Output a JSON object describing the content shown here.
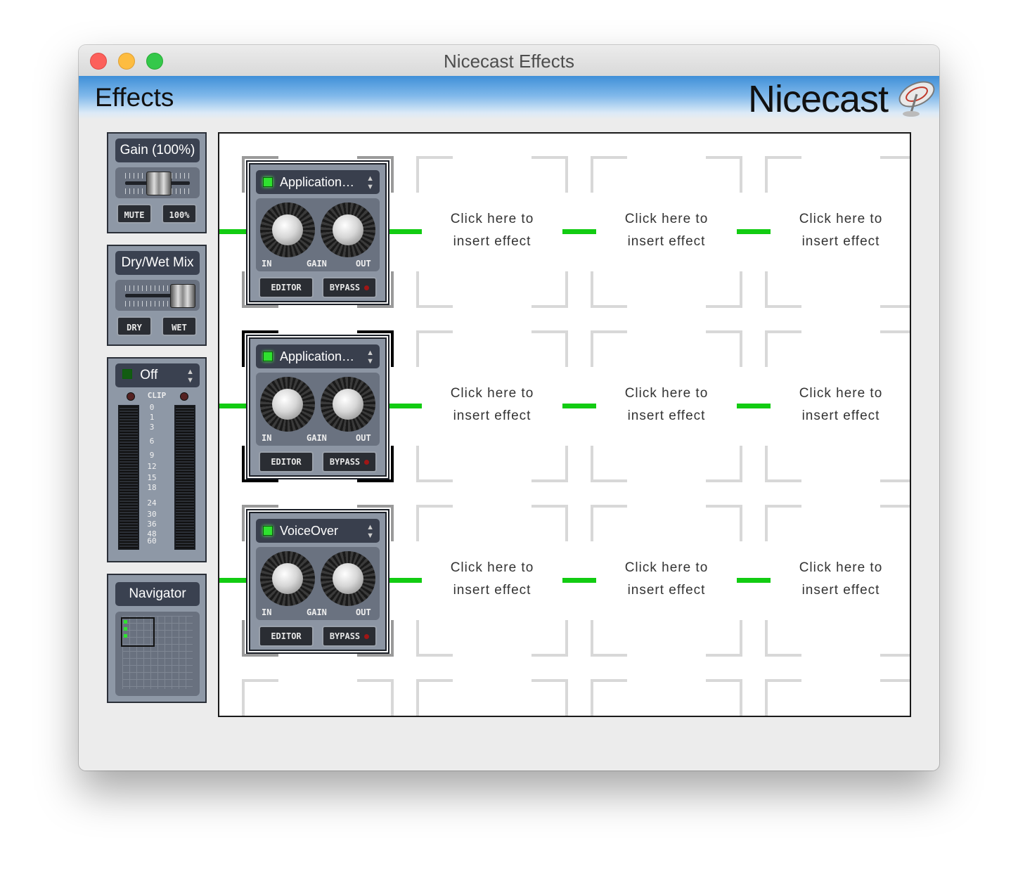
{
  "window": {
    "title": "Nicecast Effects"
  },
  "header": {
    "title": "Effects",
    "brand": "Nicecast"
  },
  "gain": {
    "title": "Gain (100%)",
    "mute": "MUTE",
    "reset": "100%",
    "level": 1.0
  },
  "mix": {
    "title": "Dry/Wet Mix",
    "dry": "DRY",
    "wet": "WET",
    "level": 1.0
  },
  "meter": {
    "mode": "Off",
    "clip": "CLIP",
    "scale": [
      "0",
      "1",
      "3",
      "6",
      "9",
      "12",
      "15",
      "18",
      "24",
      "30",
      "36",
      "48",
      "60"
    ]
  },
  "navigator": {
    "title": "Navigator"
  },
  "effects": [
    {
      "name": "Application…",
      "in": "IN",
      "gain": "GAIN",
      "out": "OUT",
      "editor": "EDITOR",
      "bypass": "BYPASS"
    },
    {
      "name": "Application…",
      "in": "IN",
      "gain": "GAIN",
      "out": "OUT",
      "editor": "EDITOR",
      "bypass": "BYPASS"
    },
    {
      "name": "VoiceOver",
      "in": "IN",
      "gain": "GAIN",
      "out": "OUT",
      "editor": "EDITOR",
      "bypass": "BYPASS"
    }
  ],
  "slots": {
    "line1": "Click here to",
    "line2": "insert effect"
  },
  "colors": {
    "signal_line": "#12cc12",
    "led_on": "#2fe22f",
    "header_blue": "#3f8fd8"
  }
}
